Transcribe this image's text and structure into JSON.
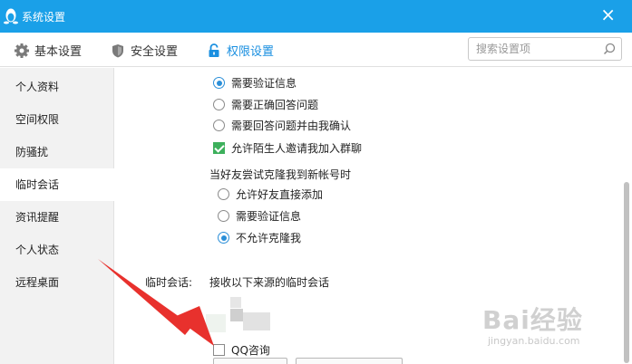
{
  "window": {
    "title": "系统设置",
    "close_glyph": "×"
  },
  "tabs": [
    {
      "label": "基本设置",
      "icon": "gear-icon",
      "active": false
    },
    {
      "label": "安全设置",
      "icon": "shield-icon",
      "active": false
    },
    {
      "label": "权限设置",
      "icon": "lock-icon",
      "active": true
    }
  ],
  "search": {
    "placeholder": "搜索设置项",
    "icon": "search-icon"
  },
  "sidebar": {
    "items": [
      {
        "label": "个人资料",
        "active": false
      },
      {
        "label": "空间权限",
        "active": false
      },
      {
        "label": "防骚扰",
        "active": false
      },
      {
        "label": "临时会话",
        "active": true
      },
      {
        "label": "资讯提醒",
        "active": false
      },
      {
        "label": "个人状态",
        "active": false
      },
      {
        "label": "远程桌面",
        "active": false
      }
    ]
  },
  "friend_options": [
    {
      "label": "需要验证信息",
      "type": "radio",
      "checked": true
    },
    {
      "label": "需要正确回答问题",
      "type": "radio",
      "checked": false
    },
    {
      "label": "需要回答问题并由我确认",
      "type": "radio",
      "checked": false
    }
  ],
  "group_invite": {
    "label": "允许陌生人邀请我加入群聊",
    "checked": true
  },
  "clone": {
    "heading": "当好友尝试克隆我到新帐号时",
    "options": [
      {
        "label": "允许好友直接添加",
        "checked": false
      },
      {
        "label": "需要验证信息",
        "checked": false
      },
      {
        "label": "不允许克隆我",
        "checked": true
      }
    ]
  },
  "temp_session": {
    "label": "临时会话:",
    "description": "接收以下来源的临时会话",
    "qq_consult": {
      "label": "QQ咨询",
      "checked": false
    }
  },
  "watermark": {
    "main": "Bai经验",
    "sub": "jingyan.baidu.com"
  },
  "colors": {
    "titlebar": "#1aa0e8",
    "accent": "#1a8fe0",
    "check_green": "#3db05c",
    "annotation_red": "#e8312d"
  }
}
